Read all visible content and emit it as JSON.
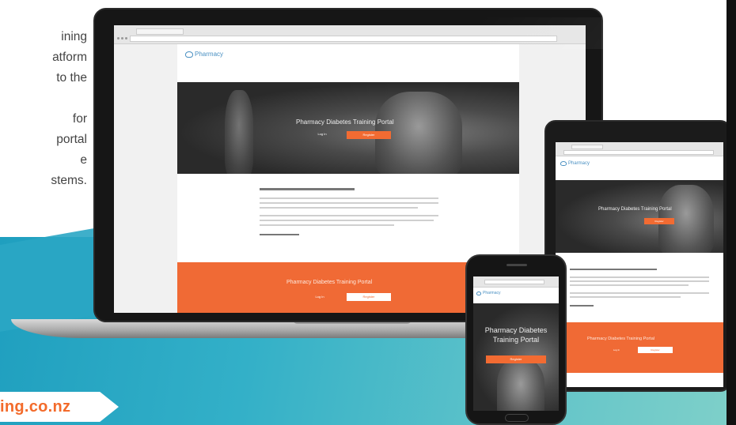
{
  "blurb": {
    "lines": [
      "ining",
      "atform",
      "to the",
      "",
      "for",
      "portal",
      "e",
      "stems."
    ]
  },
  "url_badge": "ing.co.nz",
  "portal": {
    "brand": "Pharmacy",
    "hero_title": "Pharmacy Diabetes Training Portal",
    "login_label": "Log In",
    "register_label": "Register",
    "welcome_heading": "Welcome to the Pharmacy Diabetes training portal",
    "band_title": "Pharmacy Diabetes Training Portal",
    "phone_hero_title_1": "Pharmacy Diabetes",
    "phone_hero_title_2": "Training Portal"
  },
  "colors": {
    "accent_orange": "#f26b32",
    "teal": "#33b0c8",
    "link_blue": "#4a90c2"
  },
  "icons": [
    "pharmacy-logo-icon",
    "arrow-badge"
  ]
}
